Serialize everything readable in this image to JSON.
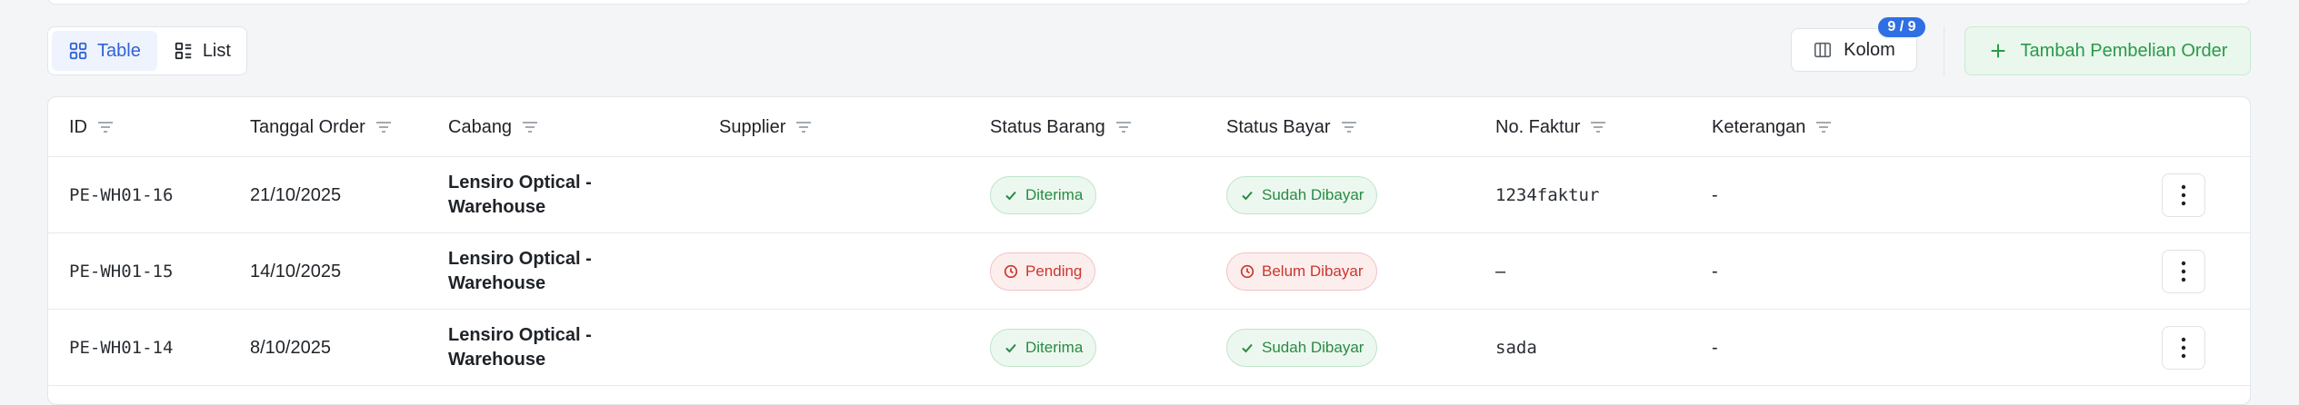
{
  "view_toggle": {
    "table_label": "Table",
    "list_label": "List"
  },
  "toolbar": {
    "kolom_label": "Kolom",
    "kolom_badge": "9 / 9",
    "add_label": "Tambah Pembelian Order"
  },
  "table": {
    "headers": {
      "id": "ID",
      "tanggal": "Tanggal Order",
      "cabang": "Cabang",
      "supplier": "Supplier",
      "status_barang": "Status Barang",
      "status_bayar": "Status Bayar",
      "no_faktur": "No. Faktur",
      "keterangan": "Keterangan"
    },
    "rows": [
      {
        "id": "PE-WH01-16",
        "tanggal": "21/10/2025",
        "cabang_1": "Lensiro Optical -",
        "cabang_2": "Warehouse",
        "supplier": "",
        "status_barang": "Diterima",
        "status_bayar": "Sudah Dibayar",
        "no_faktur": "1234faktur",
        "keterangan": "-"
      },
      {
        "id": "PE-WH01-15",
        "tanggal": "14/10/2025",
        "cabang_1": "Lensiro Optical -",
        "cabang_2": "Warehouse",
        "supplier": "",
        "status_barang": "Pending",
        "status_bayar": "Belum Dibayar",
        "no_faktur": "–",
        "keterangan": "-"
      },
      {
        "id": "PE-WH01-14",
        "tanggal": "8/10/2025",
        "cabang_1": "Lensiro Optical -",
        "cabang_2": "Warehouse",
        "supplier": "",
        "status_barang": "Diterima",
        "status_bayar": "Sudah Dibayar",
        "no_faktur": "sada",
        "keterangan": "-"
      }
    ]
  },
  "colors": {
    "accent_blue": "#2f63d6",
    "success_green": "#2a8a44",
    "danger_red": "#c9372c"
  }
}
